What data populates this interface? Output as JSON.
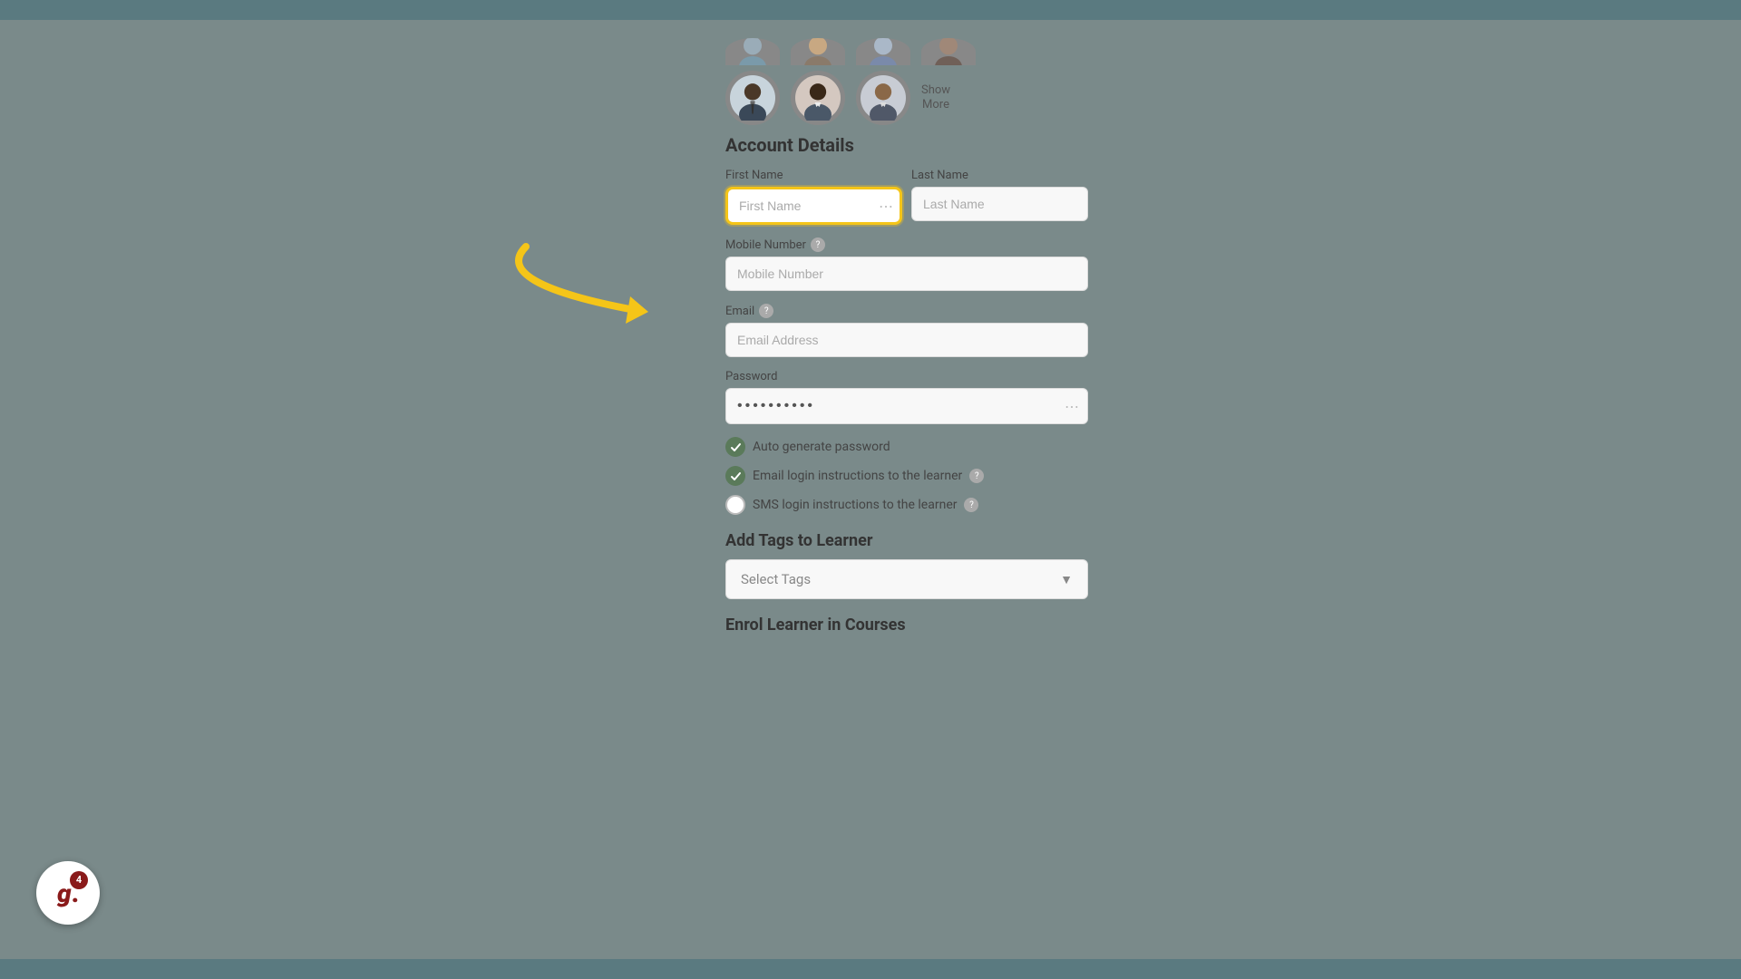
{
  "topBar": {
    "color": "#5a7a80"
  },
  "avatarRow1": [
    {
      "id": "avatar1",
      "type": "partial"
    },
    {
      "id": "avatar2",
      "type": "partial"
    },
    {
      "id": "avatar3",
      "type": "partial"
    },
    {
      "id": "avatar4",
      "type": "partial"
    }
  ],
  "avatarRow2": [
    {
      "id": "avatar5",
      "type": "full"
    },
    {
      "id": "avatar6",
      "type": "full"
    },
    {
      "id": "avatar7",
      "type": "full"
    }
  ],
  "showMore": "Show\nMore",
  "accountDetails": {
    "title": "Account Details",
    "firstNameLabel": "First Name",
    "firstNamePlaceholder": "First Name",
    "lastNameLabel": "Last Name",
    "lastNamePlaceholder": "Last Name",
    "mobileLabel": "Mobile Number",
    "mobilePlaceholder": "Mobile Number",
    "emailLabel": "Email",
    "emailPlaceholder": "Email Address",
    "passwordLabel": "Password",
    "passwordValue": "••••••••••"
  },
  "checkboxes": {
    "autoGenerate": "Auto generate password",
    "emailLogin": "Email login instructions to the learner",
    "smsLogin": "SMS login instructions to the learner"
  },
  "tagsSection": {
    "title": "Add Tags to Learner",
    "selectPlaceholder": "Select Tags"
  },
  "enrolSection": {
    "title": "Enrol Learner in Courses"
  },
  "gLogo": {
    "letter": "g",
    "dot": ".",
    "badgeCount": "4"
  }
}
